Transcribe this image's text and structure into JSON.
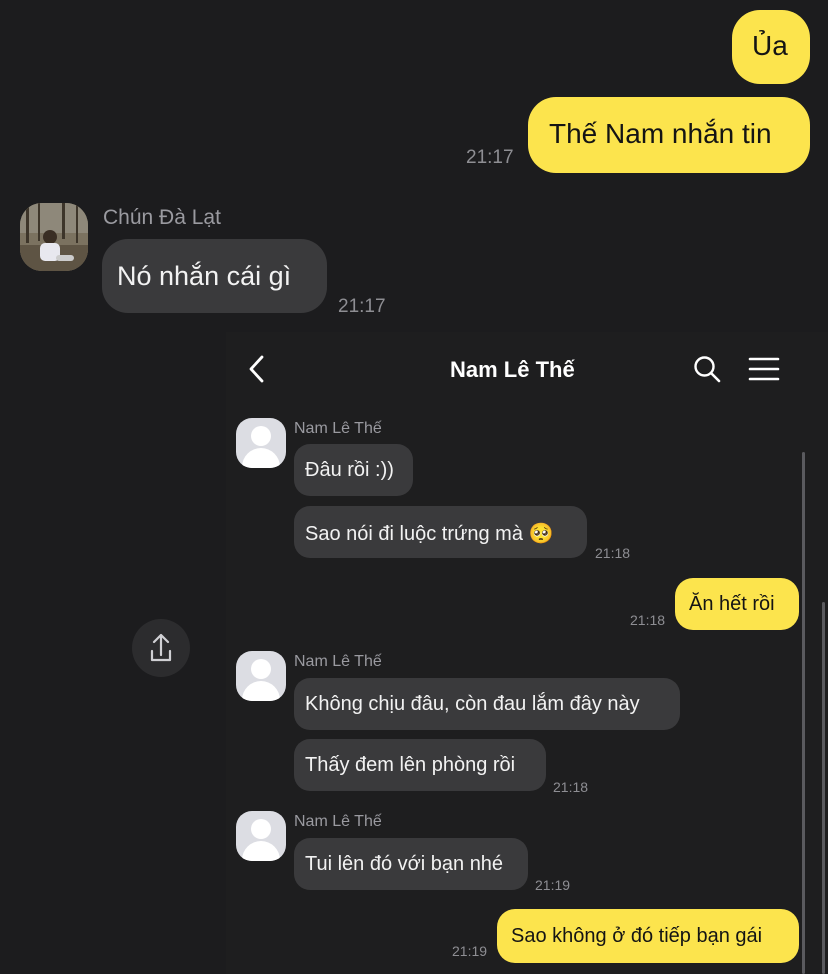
{
  "outer_chat": {
    "messages": [
      {
        "id": "m1",
        "text": "Ủa"
      },
      {
        "id": "m2",
        "text": "Thế Nam nhắn tin",
        "time": "21:17"
      }
    ],
    "sender": {
      "name": "Chún Đà Lạt",
      "message": "Nó nhắn cái gì",
      "time": "21:17"
    }
  },
  "shared_screenshot": {
    "header": {
      "title": "Nam Lê Thế"
    },
    "groups": [
      {
        "sender": "Nam Lê Thế",
        "messages": [
          "Đâu rồi :))",
          "Sao nói đi luộc trứng mà 🥺"
        ],
        "time": "21:18"
      },
      {
        "outgoing": "Ăn hết rồi",
        "time": "21:18"
      },
      {
        "sender": "Nam Lê Thế",
        "messages": [
          "Không chịu đâu, còn đau lắm đây này",
          "Thấy đem lên phòng rồi"
        ],
        "time": "21:18"
      },
      {
        "sender": "Nam Lê Thế",
        "messages": [
          "Tui lên đó với bạn nhé"
        ],
        "time": "21:19"
      },
      {
        "outgoing": "Sao không ở đó tiếp bạn gái",
        "time": "21:19"
      }
    ]
  },
  "icons": {
    "back": "chevron-left-icon",
    "search": "search-icon",
    "menu": "hamburger-menu-icon",
    "share": "share-icon"
  },
  "colors": {
    "background": "#1c1c1e",
    "own_bubble": "#fce44d",
    "other_bubble": "#3a3a3c"
  }
}
